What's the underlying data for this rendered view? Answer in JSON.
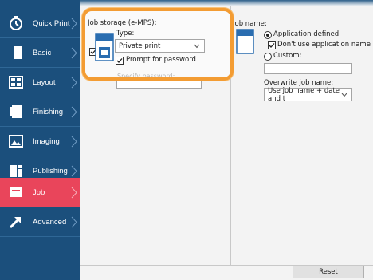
{
  "sidebar": {
    "items": [
      {
        "label": "Quick Print",
        "icon": "stopwatch-icon"
      },
      {
        "label": "Basic",
        "icon": "document-icon"
      },
      {
        "label": "Layout",
        "icon": "layout-grid-icon"
      },
      {
        "label": "Finishing",
        "icon": "finishing-icon"
      },
      {
        "label": "Imaging",
        "icon": "image-icon"
      },
      {
        "label": "Publishing",
        "icon": "booklet-icon"
      },
      {
        "label": "Job",
        "icon": "printer-job-icon"
      },
      {
        "label": "Advanced",
        "icon": "arrow-up-right-icon"
      }
    ],
    "active_index": 6
  },
  "job_storage": {
    "title": "Job storage (e-MPS):",
    "checkbox_checked": true,
    "type_label": "Type:",
    "type_value": "Private print",
    "prompt_password_label": "Prompt for password",
    "prompt_password_checked": true,
    "specify_password_label": "Specify password:"
  },
  "job_name": {
    "title": "Job name:",
    "option_application_defined": "Application defined",
    "application_defined_selected": true,
    "dont_use_app_name_label": "Don't use application name",
    "dont_use_app_name_checked": true,
    "option_custom": "Custom:",
    "custom_selected": false,
    "custom_value": "",
    "overwrite_label": "Overwrite job name:",
    "overwrite_value": "Use job name + date and t"
  },
  "reset_label": "Reset",
  "colors": {
    "sidebar_bg": "#1b4f7c",
    "active_bg": "#e9455b",
    "highlight": "#f39c33"
  }
}
